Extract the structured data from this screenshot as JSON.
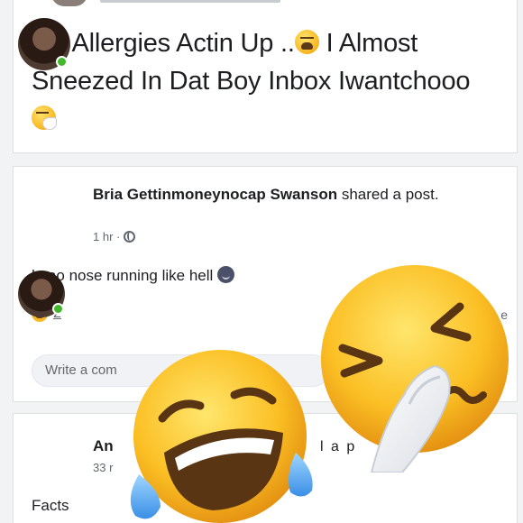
{
  "top_post": {
    "text_part1": "My Allergies Actin Up ..",
    "text_part2": " I Almost Sneezed In Dat Boy Inbox Iwantchooo ",
    "emoji_1": "weary-face-icon",
    "emoji_2": "sneezing-face-icon"
  },
  "shared_post": {
    "poster_name": "Bria Gettinmoneynocap Swanson",
    "action_text": " shared a post.",
    "time": "1 hr ·",
    "body": "lmao nose running like hell ",
    "reaction_count": "2",
    "share_fragment": "e",
    "comment_placeholder": "Write a com"
  },
  "comment": {
    "name_fragment": "An",
    "time_fragment": "33 r",
    "right_fragment": "l a p",
    "body": "Facts"
  },
  "overlay": {
    "laugh_icon": "face-with-tears-of-joy-icon",
    "sneeze_icon": "sneezing-face-icon"
  },
  "colors": {
    "online": "#42b72a",
    "emoji_yellow": "#f8b51e",
    "tear_blue": "#5ab2ff",
    "card_border": "#dddfe2"
  }
}
